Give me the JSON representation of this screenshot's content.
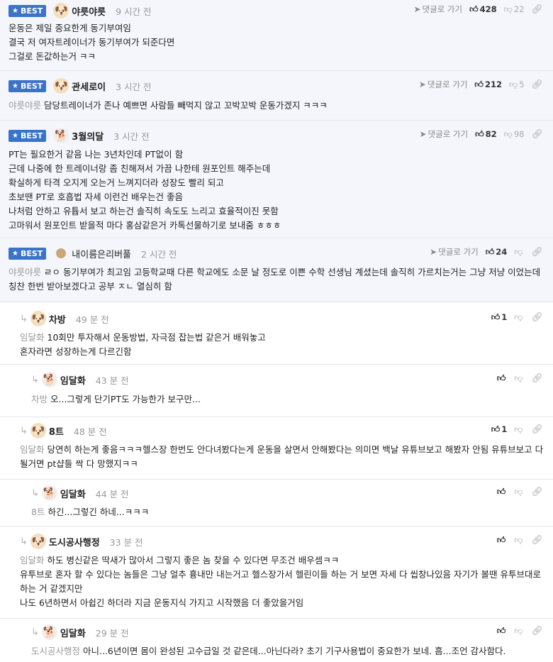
{
  "ui": {
    "best_label": "BEST",
    "goto_label": "댓글로 가기"
  },
  "comments": [
    {
      "nick": "야릇야릇",
      "time": "9 시간 전",
      "up": "428",
      "down": "22",
      "lines": [
        "운동은 제일 중요한게 동기부여임",
        "결국 저 여자트레이너가 동기부여가 되준다면",
        "그걸로 돈값하는거 ㅋㅋ"
      ]
    },
    {
      "nick": "관세로이",
      "time": "3 시간 전",
      "up": "212",
      "down": "5",
      "mention": "야릇야릇",
      "lines": [
        "담당트레이너가 존나 예쁘면 사람들 빼먹지 않고 꼬박꼬박 운동가겠지 ㅋㅋㅋ"
      ]
    },
    {
      "nick": "3월의달",
      "time": "3 시간 전",
      "up": "82",
      "down": "98",
      "lines": [
        "PT는 필요한거 같음 나는 3년차인데 PT없이 함",
        "근데 나중에 한 트레이너랑 좀 친해져서 가끔 나한테 원포인트 해주는데",
        "확실하게 타격 오지게 오는거 느껴지더라 성장도 빨리 되고",
        "초보땐 PT로 호흡법 자세 이런건 배우는건 좋음",
        "나처럼 안하고 유튭서 보고 하는건 솔직히 속도도 느리고 효율적이진 못함",
        "고마워서 원포인트 받을적 마다 홍삼같은거 카톡선물하기로 보내줌 ㅎㅎㅎ"
      ]
    },
    {
      "nick": "내이름은리버풀",
      "time": "2 시간 전",
      "up": "24",
      "mention": "야릇야릇",
      "lines": [
        "ㄹㅇ 동기부여가 최고임 고등학교때 다른 학교에도 소문 날 정도로 이쁜 수학 선생님 계셨는데 솔직히 가르치는거는 그냥 저냥 이었는데 칭찬 한번 받아보겠다고 공부 ㅈㄴ 열심히 함"
      ]
    },
    {
      "nick": "차방",
      "time": "49 분 전",
      "up": "1",
      "mention": "임달화",
      "lines": [
        "10회만 투자해서 운동방법, 자극점 잡는법 같은거 배워놓고",
        "혼자라면 성장하는게 다르긴함"
      ]
    },
    {
      "nick": "임달화",
      "time": "43 분 전",
      "mention": "차방",
      "lines": [
        "오...그렇게 단기PT도 가능한가 보구만..."
      ]
    },
    {
      "nick": "8트",
      "time": "48 분 전",
      "up": "1",
      "mention": "임달화",
      "lines": [
        "당연히 하는게 좋음ㅋㅋㅋ헬스장 한번도 안다녀봤다는게 운동을 살면서 안해봤다는 의미면 백날 유튜브보고 해봤자 안됨 유튜브보고 다 될거면 pt샵들 싹 다 망했지ㅋㅋ"
      ]
    },
    {
      "nick": "임달화",
      "time": "44 분 전",
      "mention": "8트",
      "lines": [
        "하긴...그렇긴 하네...ㅋㅋㅋ"
      ]
    },
    {
      "nick": "도시공사행정",
      "time": "33 분 전",
      "mention": "임달화",
      "lines": [
        "하도 병신같은 딱새가 많아서 그렇지 좋은 놈 찾을 수 있다면 무조건 배우셈ㅋㅋ",
        "유투브로 혼자 할 수 있다는 놈들은 그냥 얼추 흉내만 내는거고 헬스장가서 헬린이들 하는 거 보면 자세 다 씹창나있음 자기가 볼땐 유투브대로 하는 거 같겠지만",
        "나도 6년하면서 아쉽긴 하더라 지금 운동지식 가지고 시작했음 더 좋았을거임"
      ]
    },
    {
      "nick": "임달화",
      "time": "29 분 전",
      "mention": "도시공사행정",
      "lines": [
        "아니...6년이면 몸이 완성된 고수급일 것 같은데...아닌다라? 초기 기구사용법이 중요한가 보네. 흠...조언 감사함다."
      ]
    }
  ]
}
